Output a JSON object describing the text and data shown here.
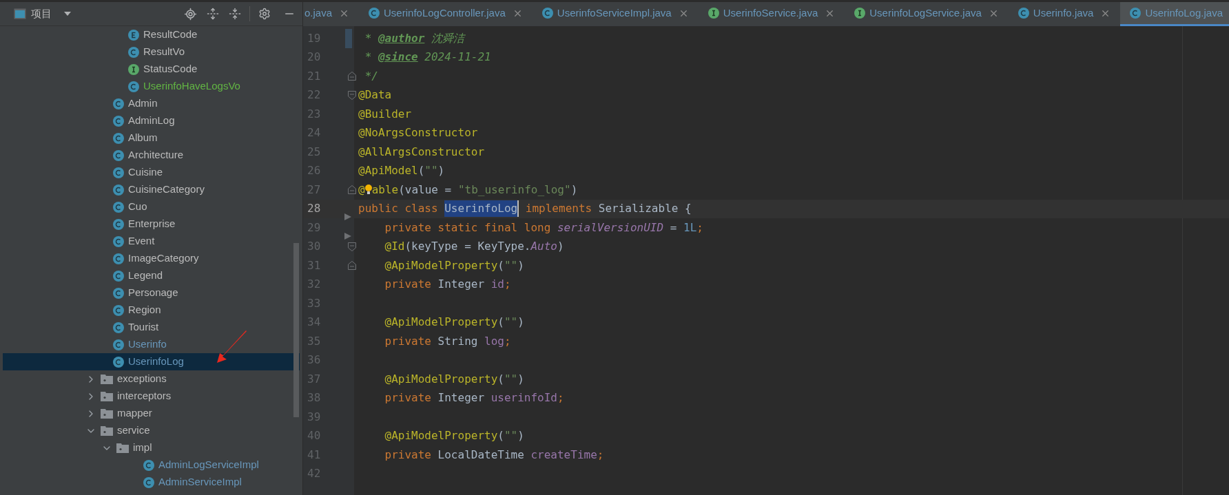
{
  "sidebar": {
    "title": "项目",
    "tree": {
      "continued_children": [
        {
          "label": "ResultCode",
          "kind": "enum",
          "added": false,
          "modified": false,
          "selected": false
        },
        {
          "label": "ResultVo",
          "kind": "class",
          "added": false,
          "modified": false,
          "selected": false
        },
        {
          "label": "StatusCode",
          "kind": "interface",
          "added": false,
          "modified": false,
          "selected": false
        },
        {
          "label": "UserinfoHaveLogsVo",
          "kind": "class",
          "added": true,
          "modified": false,
          "selected": false
        }
      ],
      "items": [
        {
          "label": "Admin",
          "kind": "class",
          "added": false,
          "modified": false,
          "selected": false
        },
        {
          "label": "AdminLog",
          "kind": "class",
          "added": false,
          "modified": false,
          "selected": false
        },
        {
          "label": "Album",
          "kind": "class",
          "added": false,
          "modified": false,
          "selected": false
        },
        {
          "label": "Architecture",
          "kind": "class",
          "added": false,
          "modified": false,
          "selected": false
        },
        {
          "label": "Cuisine",
          "kind": "class",
          "added": false,
          "modified": false,
          "selected": false
        },
        {
          "label": "CuisineCategory",
          "kind": "class",
          "added": false,
          "modified": false,
          "selected": false
        },
        {
          "label": "Cuo",
          "kind": "class",
          "added": false,
          "modified": false,
          "selected": false
        },
        {
          "label": "Enterprise",
          "kind": "class",
          "added": false,
          "modified": false,
          "selected": false
        },
        {
          "label": "Event",
          "kind": "class",
          "added": false,
          "modified": false,
          "selected": false
        },
        {
          "label": "ImageCategory",
          "kind": "class",
          "added": false,
          "modified": false,
          "selected": false
        },
        {
          "label": "Legend",
          "kind": "class",
          "added": false,
          "modified": false,
          "selected": false
        },
        {
          "label": "Personage",
          "kind": "class",
          "added": false,
          "modified": false,
          "selected": false
        },
        {
          "label": "Region",
          "kind": "class",
          "added": false,
          "modified": false,
          "selected": false
        },
        {
          "label": "Tourist",
          "kind": "class",
          "added": false,
          "modified": false,
          "selected": false
        },
        {
          "label": "Userinfo",
          "kind": "class",
          "added": false,
          "modified": true,
          "selected": false
        },
        {
          "label": "UserinfoLog",
          "kind": "class",
          "added": false,
          "modified": true,
          "selected": true
        },
        {
          "label": "exceptions",
          "kind": "folder",
          "added": false,
          "modified": false,
          "selected": false,
          "expanded": false
        },
        {
          "label": "interceptors",
          "kind": "folder",
          "added": false,
          "modified": false,
          "selected": false,
          "expanded": false
        },
        {
          "label": "mapper",
          "kind": "folder",
          "added": false,
          "modified": false,
          "selected": false,
          "expanded": false
        },
        {
          "label": "service",
          "kind": "folder",
          "added": false,
          "modified": false,
          "selected": false,
          "expanded": true,
          "children": [
            {
              "label": "impl",
              "kind": "folder",
              "added": false,
              "modified": false,
              "selected": false,
              "expanded": true,
              "children": [
                {
                  "label": "AdminLogServiceImpl",
                  "kind": "class",
                  "added": false,
                  "modified": true,
                  "selected": false
                },
                {
                  "label": "AdminServiceImpl",
                  "kind": "class",
                  "added": false,
                  "modified": true,
                  "selected": false
                }
              ]
            }
          ]
        }
      ]
    }
  },
  "tabs": [
    {
      "label": "o.java",
      "selected": false
    },
    {
      "label": "UserinfoLogController.java",
      "kind": "class",
      "selected": false
    },
    {
      "label": "UserinfoServiceImpl.java",
      "kind": "class",
      "selected": false
    },
    {
      "label": "UserinfoService.java",
      "kind": "interface",
      "selected": false
    },
    {
      "label": "UserinfoLogService.java",
      "kind": "interface",
      "selected": false
    },
    {
      "label": "Userinfo.java",
      "kind": "class",
      "selected": false
    },
    {
      "label": "UserinfoLog.java",
      "kind": "class",
      "selected": true
    }
  ],
  "editor": {
    "lines": [
      {
        "number": "19",
        "changed": true,
        "tokens": [
          {
            "kind": "comment",
            "text": " * "
          },
          {
            "kind": "doctag",
            "text": "@author"
          },
          {
            "kind": "comment",
            "text": " 沈舜洁"
          }
        ]
      },
      {
        "number": "20",
        "tokens": [
          {
            "kind": "comment",
            "text": " * "
          },
          {
            "kind": "doctag",
            "text": "@since"
          },
          {
            "kind": "comment",
            "text": " 2024-11-21"
          }
        ]
      },
      {
        "number": "21",
        "fold_end": true,
        "tokens": [
          {
            "kind": "comment",
            "text": " */"
          }
        ]
      },
      {
        "number": "22",
        "fold_start": true,
        "tokens": [
          {
            "kind": "annotation",
            "text": "@Data"
          }
        ]
      },
      {
        "number": "23",
        "tokens": [
          {
            "kind": "annotation",
            "text": "@Builder"
          }
        ]
      },
      {
        "number": "24",
        "tokens": [
          {
            "kind": "annotation",
            "text": "@NoArgsConstructor"
          }
        ]
      },
      {
        "number": "25",
        "tokens": [
          {
            "kind": "annotation",
            "text": "@AllArgsConstructor"
          }
        ]
      },
      {
        "number": "26",
        "tokens": [
          {
            "kind": "annotation",
            "text": "@ApiModel"
          },
          {
            "kind": "plain",
            "text": "("
          },
          {
            "kind": "string",
            "text": "\"\""
          },
          {
            "kind": "plain",
            "text": ")"
          }
        ]
      },
      {
        "number": "27",
        "fold_end": true,
        "tokens": [
          {
            "kind": "annotation",
            "text": "@"
          },
          {
            "kind": "bulb"
          },
          {
            "kind": "annotation",
            "text": "able"
          },
          {
            "kind": "plain",
            "text": "(value = "
          },
          {
            "kind": "string",
            "text": "\"tb_userinfo_log\""
          },
          {
            "kind": "plain",
            "text": ")"
          }
        ]
      },
      {
        "number": "28",
        "current": true,
        "tokens": [
          {
            "kind": "keyword",
            "text": "public class "
          },
          {
            "kind": "selection",
            "text": "UserinfoLog"
          },
          {
            "kind": "keyword",
            "text": " implements "
          },
          {
            "kind": "plain",
            "text": "Serializable {"
          }
        ]
      },
      {
        "number": "29",
        "marker": true,
        "tokens": [
          {
            "kind": "keyword",
            "text": "    private static final long "
          },
          {
            "kind": "static",
            "text": "serialVersionUID"
          },
          {
            "kind": "plain",
            "text": " = "
          },
          {
            "kind": "number",
            "text": "1L"
          },
          {
            "kind": "keyword",
            "text": ";"
          }
        ]
      },
      {
        "number": "30",
        "marker": true,
        "fold_start": true,
        "tokens": [
          {
            "kind": "annotation",
            "text": "    @Id"
          },
          {
            "kind": "plain",
            "text": "(keyType = KeyType."
          },
          {
            "kind": "static",
            "text": "Auto"
          },
          {
            "kind": "plain",
            "text": ")"
          }
        ]
      },
      {
        "number": "31",
        "fold_end": true,
        "tokens": [
          {
            "kind": "annotation",
            "text": "    @ApiModelProperty"
          },
          {
            "kind": "plain",
            "text": "("
          },
          {
            "kind": "string",
            "text": "\"\""
          },
          {
            "kind": "plain",
            "text": ")"
          }
        ]
      },
      {
        "number": "32",
        "tokens": [
          {
            "kind": "keyword",
            "text": "    private "
          },
          {
            "kind": "plain",
            "text": "Integer "
          },
          {
            "kind": "field",
            "text": "id"
          },
          {
            "kind": "keyword",
            "text": ";"
          }
        ]
      },
      {
        "number": "33"
      },
      {
        "number": "34",
        "tokens": [
          {
            "kind": "annotation",
            "text": "    @ApiModelProperty"
          },
          {
            "kind": "plain",
            "text": "("
          },
          {
            "kind": "string",
            "text": "\"\""
          },
          {
            "kind": "plain",
            "text": ")"
          }
        ]
      },
      {
        "number": "35",
        "tokens": [
          {
            "kind": "keyword",
            "text": "    private "
          },
          {
            "kind": "plain",
            "text": "String "
          },
          {
            "kind": "field",
            "text": "log"
          },
          {
            "kind": "keyword",
            "text": ";"
          }
        ]
      },
      {
        "number": "36"
      },
      {
        "number": "37",
        "tokens": [
          {
            "kind": "annotation",
            "text": "    @ApiModelProperty"
          },
          {
            "kind": "plain",
            "text": "("
          },
          {
            "kind": "string",
            "text": "\"\""
          },
          {
            "kind": "plain",
            "text": ")"
          }
        ]
      },
      {
        "number": "38",
        "tokens": [
          {
            "kind": "keyword",
            "text": "    private "
          },
          {
            "kind": "plain",
            "text": "Integer "
          },
          {
            "kind": "field",
            "text": "userinfoId"
          },
          {
            "kind": "keyword",
            "text": ";"
          }
        ]
      },
      {
        "number": "39"
      },
      {
        "number": "40",
        "tokens": [
          {
            "kind": "annotation",
            "text": "    @ApiModelProperty"
          },
          {
            "kind": "plain",
            "text": "("
          },
          {
            "kind": "string",
            "text": "\"\""
          },
          {
            "kind": "plain",
            "text": ")"
          }
        ]
      },
      {
        "number": "41",
        "tokens": [
          {
            "kind": "keyword",
            "text": "    private "
          },
          {
            "kind": "plain",
            "text": "LocalDateTime "
          },
          {
            "kind": "field",
            "text": "createTime"
          },
          {
            "kind": "keyword",
            "text": ";"
          }
        ]
      },
      {
        "number": "42"
      }
    ]
  }
}
